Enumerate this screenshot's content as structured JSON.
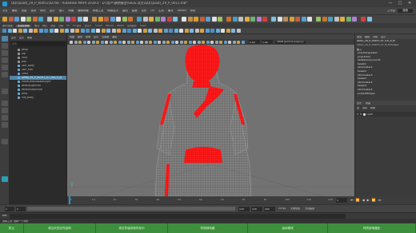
{
  "window": {
    "title": "QQ(Quad)_29_P_000515D.mb - Autodesk MAYA 2018.4 - D:\\用户\\旗袍模型\\S02E.项目\\QQ(Quad)_29_P_0015.mb*",
    "minimize": "—",
    "maximize": "□",
    "close": "✕"
  },
  "menubar": {
    "items": [
      "文件",
      "编辑",
      "创建",
      "选择",
      "修改",
      "显示",
      "窗口",
      "网格",
      "编辑网格",
      "网格工具",
      "网格显示",
      "曲线",
      "曲面",
      "变形",
      "UV",
      "生成",
      "缓存",
      "Arnold",
      "帮助"
    ],
    "workspace_label": "工作区:",
    "workspace_value": "建模"
  },
  "shelf_tabs": [
    "曲线/曲面",
    "多边形建模",
    "雕刻",
    "绑定",
    "动画",
    "渲染",
    "FX",
    "FX 缓存",
    "自定义",
    "Arnold",
    "Bifrost",
    "MASH",
    "运动图形",
    "XGen"
  ],
  "outliner": {
    "menu": [
      "显示",
      "显示",
      "帮助"
    ],
    "search_placeholder": "搜索...",
    "items": [
      {
        "label": "persp",
        "selected": false
      },
      {
        "label": "top",
        "selected": false
      },
      {
        "label": "front",
        "selected": false
      },
      {
        "label": "side",
        "selected": false
      },
      {
        "label": "Lam_Body",
        "selected": false
      },
      {
        "label": "Lam_Hair",
        "selected": false
      },
      {
        "label": "Dress",
        "selected": false
      },
      {
        "label": "QiPao_29_P_0015T_07_Intr_P_M",
        "selected": true
      },
      {
        "label": "TurtleDefaultBakeLayer",
        "selected": false
      },
      {
        "label": "defaultLightSet",
        "selected": false
      },
      {
        "label": "defaultObjectSet",
        "selected": false
      },
      {
        "label": "body",
        "selected": false
      },
      {
        "label": "role_body",
        "selected": false
      }
    ]
  },
  "viewport": {
    "menu": [
      "视图",
      "着色",
      "照明",
      "显示",
      "渲染器",
      "面板"
    ],
    "toolbar_value": "0.00",
    "toolbar_value2": "1.00",
    "colorspace": "sRGB gamma (legacy)"
  },
  "channelbox": {
    "header": "QiPao_29_P_0015T_07_Intr_P_M",
    "shape_label": "QiPao_29_P_0015T_07_M_EhShape",
    "menu": [
      "通道",
      "编辑",
      "对象",
      "显示"
    ],
    "inputs_label": "输入",
    "inputs": [
      "polyTriangulate1",
      "polyUnite1",
      "deleteComponent1",
      "tweak1",
      "skinCluster1",
      "tweak3",
      "skinCluster3",
      "tweak2",
      "skinCluster2",
      "tweak4",
      "skinCluster4",
      "polySoftEdge1"
    ],
    "layer_tabs": [
      "显示",
      "动画"
    ],
    "layer_menu": [
      "层",
      "选项",
      "帮助"
    ],
    "layer_name": "Light"
  },
  "timeline": {
    "ticks": [
      "1",
      "10",
      "20",
      "30",
      "40",
      "50",
      "60",
      "70",
      "80",
      "90",
      "100",
      "110",
      "120"
    ],
    "current_frame": "1"
  },
  "range": {
    "start": "1",
    "start_inner": "1",
    "end_inner": "120",
    "end": "120",
    "anim_end": "200",
    "fps": "24 fps",
    "char_set": "无角色集",
    "anim_layer": "无动画层"
  },
  "cmdline": {
    "lang": "MEL",
    "placeholder": ""
  },
  "helpline": {
    "text": "选择工具: 选择一个对象"
  },
  "taskbar": {
    "sections": [
      "防止",
      "将当天的文件结构",
      "将文件保存到内存中",
      "材质到电路",
      "运动修改",
      "材质到电路处"
    ]
  },
  "colors": {
    "selection_red": "#ff1a1a",
    "wire_gray": "#c8c8c8",
    "accent_blue": "#5285a6",
    "taskbar_green": "#3d8e3d"
  }
}
